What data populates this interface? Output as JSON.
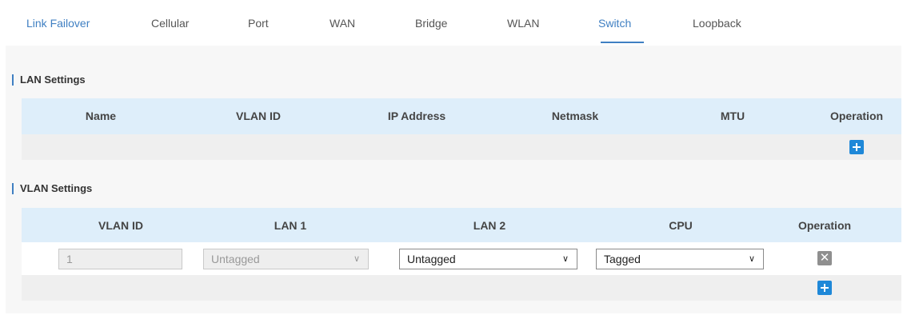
{
  "tabs": {
    "items": [
      {
        "label": "Link Failover"
      },
      {
        "label": "Cellular"
      },
      {
        "label": "Port"
      },
      {
        "label": "WAN"
      },
      {
        "label": "Bridge"
      },
      {
        "label": "WLAN"
      },
      {
        "label": "Switch"
      },
      {
        "label": "Loopback"
      }
    ],
    "active": "Switch"
  },
  "lan_settings": {
    "title": "LAN Settings",
    "columns": [
      "Name",
      "VLAN ID",
      "IP Address",
      "Netmask",
      "MTU",
      "Operation"
    ],
    "rows": []
  },
  "vlan_settings": {
    "title": "VLAN Settings",
    "columns": [
      "VLAN ID",
      "LAN 1",
      "LAN 2",
      "CPU",
      "Operation"
    ],
    "rows": [
      {
        "vlan_id": "1",
        "lan1": "Untagged",
        "lan2": "Untagged",
        "cpu": "Tagged"
      }
    ]
  },
  "colors": {
    "accent": "#3f7fc2",
    "header_bg": "#deeefa",
    "add_button": "#1f88d8",
    "delete_button": "#8f8f8f"
  },
  "icons": {
    "add": "plus-icon",
    "delete": "close-icon",
    "dropdown": "chevron-down-icon"
  }
}
